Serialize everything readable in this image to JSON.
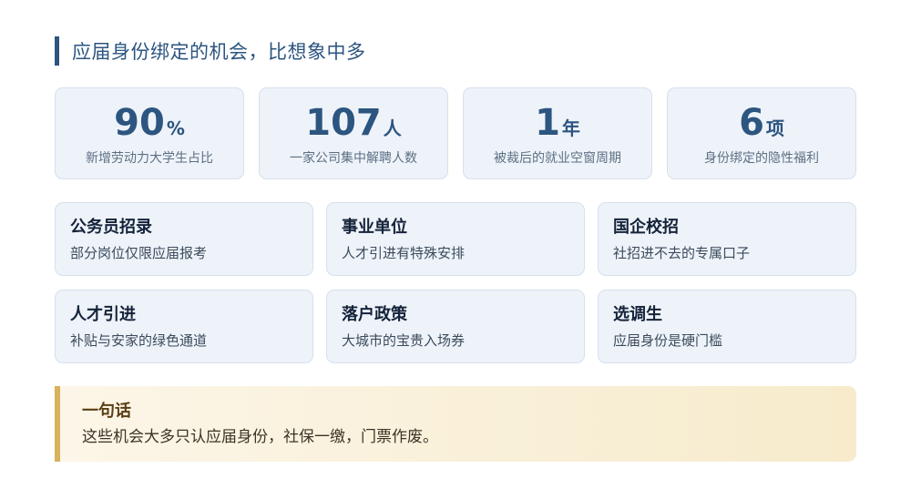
{
  "header": {
    "title": "应届身份绑定的机会，比想象中多"
  },
  "stats": [
    {
      "value": "90",
      "unit": "%",
      "label": "新增劳动力大学生占比"
    },
    {
      "value": "107",
      "unit": "人",
      "label": "一家公司集中解聘人数"
    },
    {
      "value": "1",
      "unit": "年",
      "label": "被裁后的就业空窗周期"
    },
    {
      "value": "6",
      "unit": "项",
      "label": "身份绑定的隐性福利"
    }
  ],
  "cards": [
    {
      "title": "公务员招录",
      "desc": "部分岗位仅限应届报考"
    },
    {
      "title": "事业单位",
      "desc": "人才引进有特殊安排"
    },
    {
      "title": "国企校招",
      "desc": "社招进不去的专属口子"
    },
    {
      "title": "人才引进",
      "desc": "补贴与安家的绿色通道"
    },
    {
      "title": "落户政策",
      "desc": "大城市的宝贵入场券"
    },
    {
      "title": "选调生",
      "desc": "应届身份是硬门槛"
    }
  ],
  "note": {
    "title": "一句话",
    "text": "这些机会大多只认应届身份，社保一缴，门票作废。"
  },
  "colors": {
    "accent": "#2c5580",
    "card_bg": "#eef3f9",
    "note_border": "#d8b15a",
    "note_bg": "#f7ebcc"
  }
}
